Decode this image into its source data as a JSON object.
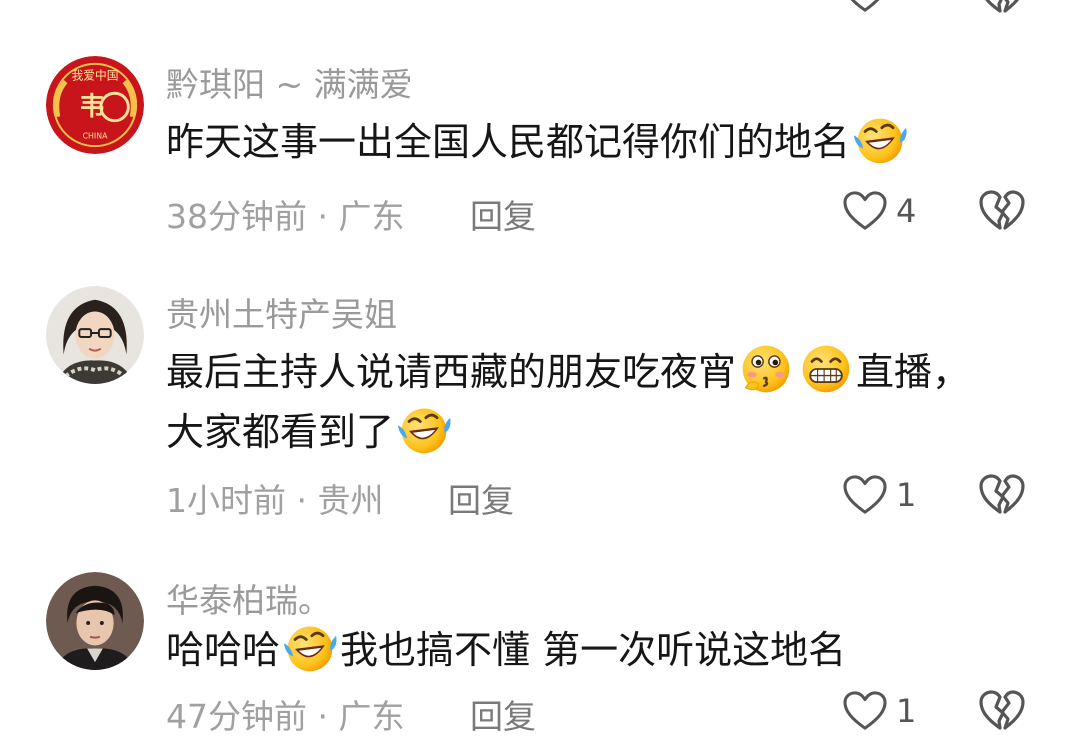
{
  "comments": [
    {
      "username": "黔琪阳 ~ 满满爱",
      "text_before": "昨天这事一出全国人民都记得你们的地名",
      "emoji_after": "laughing-crying-emoji",
      "time": "38分钟前",
      "separator": "·",
      "location": "广东",
      "reply_label": "回复",
      "like_count": "4",
      "avatar": "red-badge-avatar"
    },
    {
      "username": "贵州土特产吴姐",
      "text_part1": "最后主持人说请西藏的朋友吃夜宵",
      "emoji_1": "thinking-blush-emoji",
      "emoji_2": "grinning-teeth-emoji",
      "text_part2": "直播，",
      "text_line2": "大家都看到了",
      "emoji_3": "laughing-crying-emoji",
      "time": "1小时前",
      "separator": "·",
      "location": "贵州",
      "reply_label": "回复",
      "like_count": "1",
      "avatar": "woman-glasses-avatar"
    },
    {
      "username": "华泰柏瑞。",
      "text_part1": "哈哈哈",
      "emoji_1": "laughing-crying-emoji",
      "text_part2": "我也搞不懂 第一次听说这地名",
      "time": "47分钟前",
      "separator": "·",
      "location": "广东",
      "reply_label": "回复",
      "like_count": "1",
      "avatar": "young-man-avatar"
    }
  ],
  "icons": {
    "like": "heart-outline-icon",
    "dislike": "broken-heart-icon"
  },
  "colors": {
    "username": "#9a9a9a",
    "text": "#161616",
    "meta": "#a0a0a0",
    "icon": "#555555"
  }
}
